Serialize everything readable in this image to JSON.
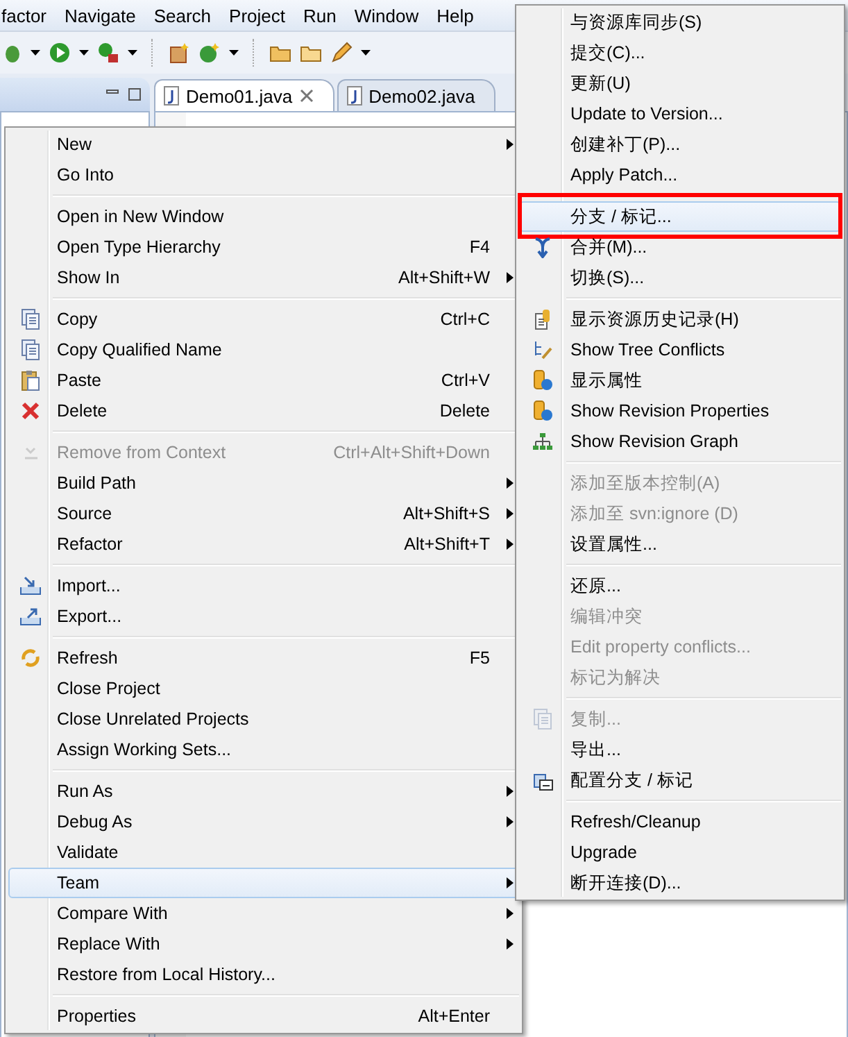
{
  "menu_bar": [
    {
      "label": "factor"
    },
    {
      "label": "Navigate"
    },
    {
      "label": "Search"
    },
    {
      "label": "Project"
    },
    {
      "label": "Run"
    },
    {
      "label": "Window"
    },
    {
      "label": "Help"
    }
  ],
  "editor": {
    "tabs": [
      {
        "label": "Demo01.java",
        "selected": true,
        "closable": true
      },
      {
        "label": "Demo02.java",
        "selected": false,
        "closable": false
      }
    ]
  },
  "context_menu": {
    "sections": [
      [
        {
          "label": "New",
          "submenu": true,
          "disabled": false,
          "selected": false
        },
        {
          "label": "Go Into",
          "submenu": false,
          "disabled": false,
          "selected": false
        }
      ],
      [
        {
          "label": "Open in New Window",
          "submenu": false,
          "disabled": false,
          "selected": false
        },
        {
          "label": "Open Type Hierarchy",
          "shortcut": "F4",
          "submenu": false,
          "disabled": false,
          "selected": false
        },
        {
          "label": "Show In",
          "shortcut": "Alt+Shift+W",
          "submenu": true,
          "disabled": false,
          "selected": false
        }
      ],
      [
        {
          "label": "Copy",
          "shortcut": "Ctrl+C",
          "submenu": false,
          "disabled": false,
          "selected": false
        },
        {
          "label": "Copy Qualified Name",
          "submenu": false,
          "disabled": false,
          "selected": false
        },
        {
          "label": "Paste",
          "shortcut": "Ctrl+V",
          "submenu": false,
          "disabled": false,
          "selected": false
        },
        {
          "label": "Delete",
          "shortcut": "Delete",
          "submenu": false,
          "disabled": false,
          "selected": false
        }
      ],
      [
        {
          "label": "Remove from Context",
          "shortcut": "Ctrl+Alt+Shift+Down",
          "submenu": false,
          "disabled": true,
          "selected": false
        },
        {
          "label": "Build Path",
          "submenu": true,
          "disabled": false,
          "selected": false
        },
        {
          "label": "Source",
          "shortcut": "Alt+Shift+S",
          "submenu": true,
          "disabled": false,
          "selected": false
        },
        {
          "label": "Refactor",
          "shortcut": "Alt+Shift+T",
          "submenu": true,
          "disabled": false,
          "selected": false
        }
      ],
      [
        {
          "label": "Import...",
          "submenu": false,
          "disabled": false,
          "selected": false
        },
        {
          "label": "Export...",
          "submenu": false,
          "disabled": false,
          "selected": false
        }
      ],
      [
        {
          "label": "Refresh",
          "shortcut": "F5",
          "submenu": false,
          "disabled": false,
          "selected": false
        },
        {
          "label": "Close Project",
          "submenu": false,
          "disabled": false,
          "selected": false
        },
        {
          "label": "Close Unrelated Projects",
          "submenu": false,
          "disabled": false,
          "selected": false
        },
        {
          "label": "Assign Working Sets...",
          "submenu": false,
          "disabled": false,
          "selected": false
        }
      ],
      [
        {
          "label": "Run As",
          "submenu": true,
          "disabled": false,
          "selected": false
        },
        {
          "label": "Debug As",
          "submenu": true,
          "disabled": false,
          "selected": false
        },
        {
          "label": "Validate",
          "submenu": false,
          "disabled": false,
          "selected": false
        },
        {
          "label": "Team",
          "submenu": true,
          "disabled": false,
          "selected": true
        },
        {
          "label": "Compare With",
          "submenu": true,
          "disabled": false,
          "selected": false
        },
        {
          "label": "Replace With",
          "submenu": true,
          "disabled": false,
          "selected": false
        },
        {
          "label": "Restore from Local History...",
          "submenu": false,
          "disabled": false,
          "selected": false
        }
      ],
      [
        {
          "label": "Properties",
          "shortcut": "Alt+Enter",
          "submenu": false,
          "disabled": false,
          "selected": false
        }
      ]
    ]
  },
  "team_submenu": {
    "sections": [
      [
        {
          "label": "与资源库同步(S)",
          "disabled": false,
          "selected": false,
          "highlighted": false
        },
        {
          "label": "提交(C)...",
          "disabled": false,
          "selected": false,
          "highlighted": false
        },
        {
          "label": "更新(U)",
          "disabled": false,
          "selected": false,
          "highlighted": false
        },
        {
          "label": "Update to Version...",
          "disabled": false,
          "selected": false,
          "highlighted": false
        },
        {
          "label": "创建补丁(P)...",
          "disabled": false,
          "selected": false,
          "highlighted": false
        },
        {
          "label": "Apply Patch...",
          "disabled": false,
          "selected": false,
          "highlighted": false
        }
      ],
      [
        {
          "label": "分支 / 标记...",
          "disabled": false,
          "selected": true,
          "highlighted": true
        },
        {
          "label": "合并(M)...",
          "disabled": false,
          "selected": false,
          "highlighted": false
        },
        {
          "label": "切换(S)...",
          "disabled": false,
          "selected": false,
          "highlighted": false
        }
      ],
      [
        {
          "label": "显示资源历史记录(H)",
          "disabled": false,
          "selected": false,
          "highlighted": false
        },
        {
          "label": "Show Tree Conflicts",
          "disabled": false,
          "selected": false,
          "highlighted": false
        },
        {
          "label": "显示属性",
          "disabled": false,
          "selected": false,
          "highlighted": false
        },
        {
          "label": "Show Revision Properties",
          "disabled": false,
          "selected": false,
          "highlighted": false
        },
        {
          "label": "Show Revision Graph",
          "disabled": false,
          "selected": false,
          "highlighted": false
        }
      ],
      [
        {
          "label": "添加至版本控制(A)",
          "disabled": true,
          "selected": false,
          "highlighted": false
        },
        {
          "label": "添加至 svn:ignore (D)",
          "disabled": true,
          "selected": false,
          "highlighted": false
        },
        {
          "label": "设置属性...",
          "disabled": false,
          "selected": false,
          "highlighted": false
        }
      ],
      [
        {
          "label": "还原...",
          "disabled": false,
          "selected": false,
          "highlighted": false
        },
        {
          "label": "编辑冲突",
          "disabled": true,
          "selected": false,
          "highlighted": false
        },
        {
          "label": "Edit property conflicts...",
          "disabled": true,
          "selected": false,
          "highlighted": false
        },
        {
          "label": "标记为解决",
          "disabled": true,
          "selected": false,
          "highlighted": false
        }
      ],
      [
        {
          "label": "复制...",
          "disabled": true,
          "selected": false,
          "highlighted": false
        },
        {
          "label": "导出...",
          "disabled": false,
          "selected": false,
          "highlighted": false
        },
        {
          "label": "配置分支 / 标记",
          "disabled": false,
          "selected": false,
          "highlighted": false
        }
      ],
      [
        {
          "label": "Refresh/Cleanup",
          "disabled": false,
          "selected": false,
          "highlighted": false
        },
        {
          "label": "Upgrade",
          "disabled": false,
          "selected": false,
          "highlighted": false
        },
        {
          "label": "断开连接(D)...",
          "disabled": false,
          "selected": false,
          "highlighted": false
        }
      ]
    ]
  }
}
